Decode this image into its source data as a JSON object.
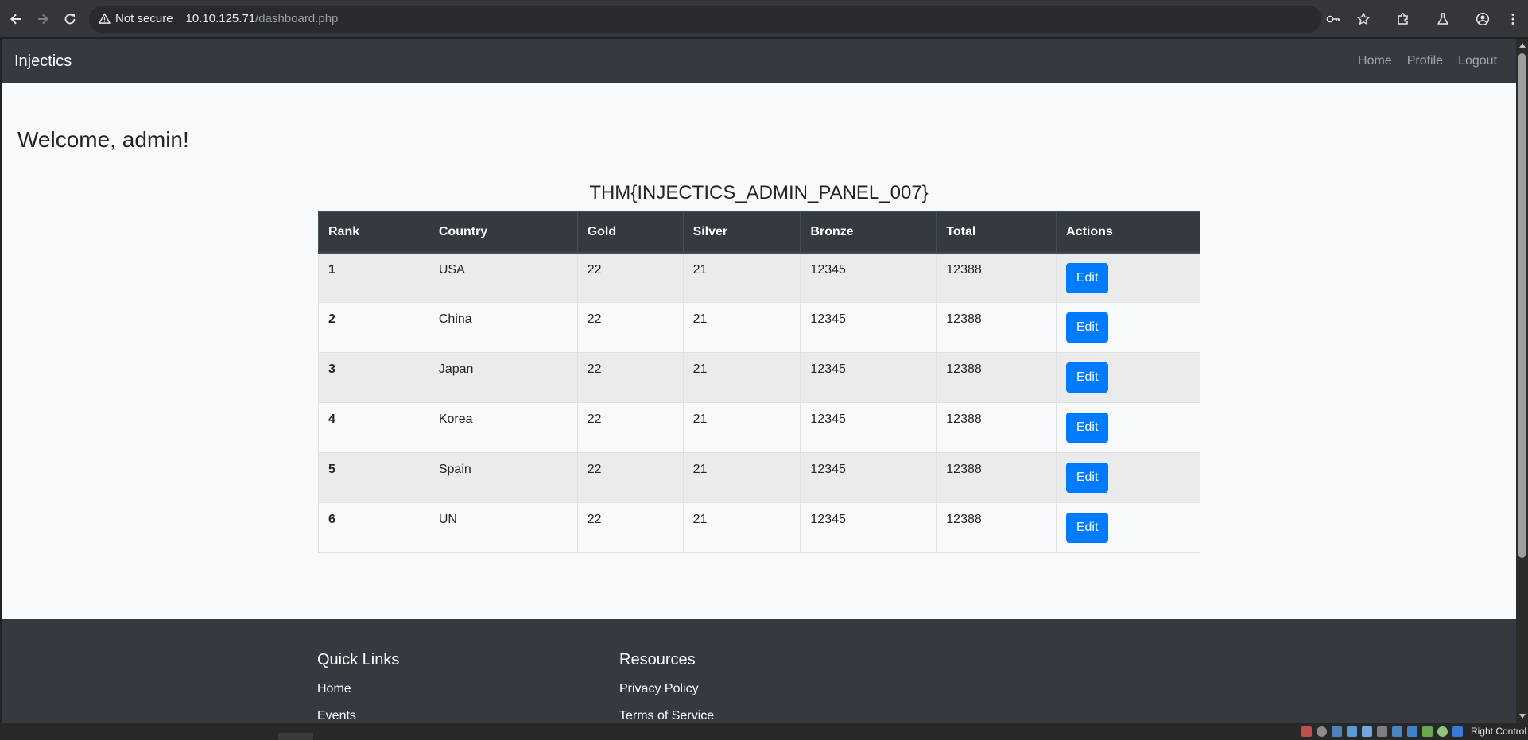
{
  "browser": {
    "security_label": "Not secure",
    "url_host": "10.10.125.71",
    "url_path": "/dashboard.php",
    "icons": [
      "back-icon",
      "forward-icon",
      "reload-icon",
      "warning-icon",
      "key-icon",
      "star-icon",
      "extensions-icon",
      "labs-icon",
      "profile-icon",
      "menu-icon"
    ]
  },
  "navbar": {
    "brand": "Injectics",
    "links": [
      "Home",
      "Profile",
      "Logout"
    ]
  },
  "main": {
    "welcome": "Welcome, admin!",
    "flag": "THM{INJECTICS_ADMIN_PANEL_007}"
  },
  "table": {
    "headers": [
      "Rank",
      "Country",
      "Gold",
      "Silver",
      "Bronze",
      "Total",
      "Actions"
    ],
    "rows": [
      {
        "rank": "1",
        "country": "USA",
        "gold": "22",
        "silver": "21",
        "bronze": "12345",
        "total": "12388",
        "action": "Edit"
      },
      {
        "rank": "2",
        "country": "China",
        "gold": "22",
        "silver": "21",
        "bronze": "12345",
        "total": "12388",
        "action": "Edit"
      },
      {
        "rank": "3",
        "country": "Japan",
        "gold": "22",
        "silver": "21",
        "bronze": "12345",
        "total": "12388",
        "action": "Edit"
      },
      {
        "rank": "4",
        "country": "Korea",
        "gold": "22",
        "silver": "21",
        "bronze": "12345",
        "total": "12388",
        "action": "Edit"
      },
      {
        "rank": "5",
        "country": "Spain",
        "gold": "22",
        "silver": "21",
        "bronze": "12345",
        "total": "12388",
        "action": "Edit"
      },
      {
        "rank": "6",
        "country": "UN",
        "gold": "22",
        "silver": "21",
        "bronze": "12345",
        "total": "12388",
        "action": "Edit"
      }
    ]
  },
  "footer": {
    "quick_links_title": "Quick Links",
    "quick_links": [
      "Home",
      "Events"
    ],
    "resources_title": "Resources",
    "resources": [
      "Privacy Policy",
      "Terms of Service"
    ]
  },
  "statusbar": {
    "host_key": "Right Control"
  },
  "colors": {
    "navbar_bg": "#343a40",
    "page_bg": "#f8f9fa",
    "button_primary": "#007bff"
  }
}
